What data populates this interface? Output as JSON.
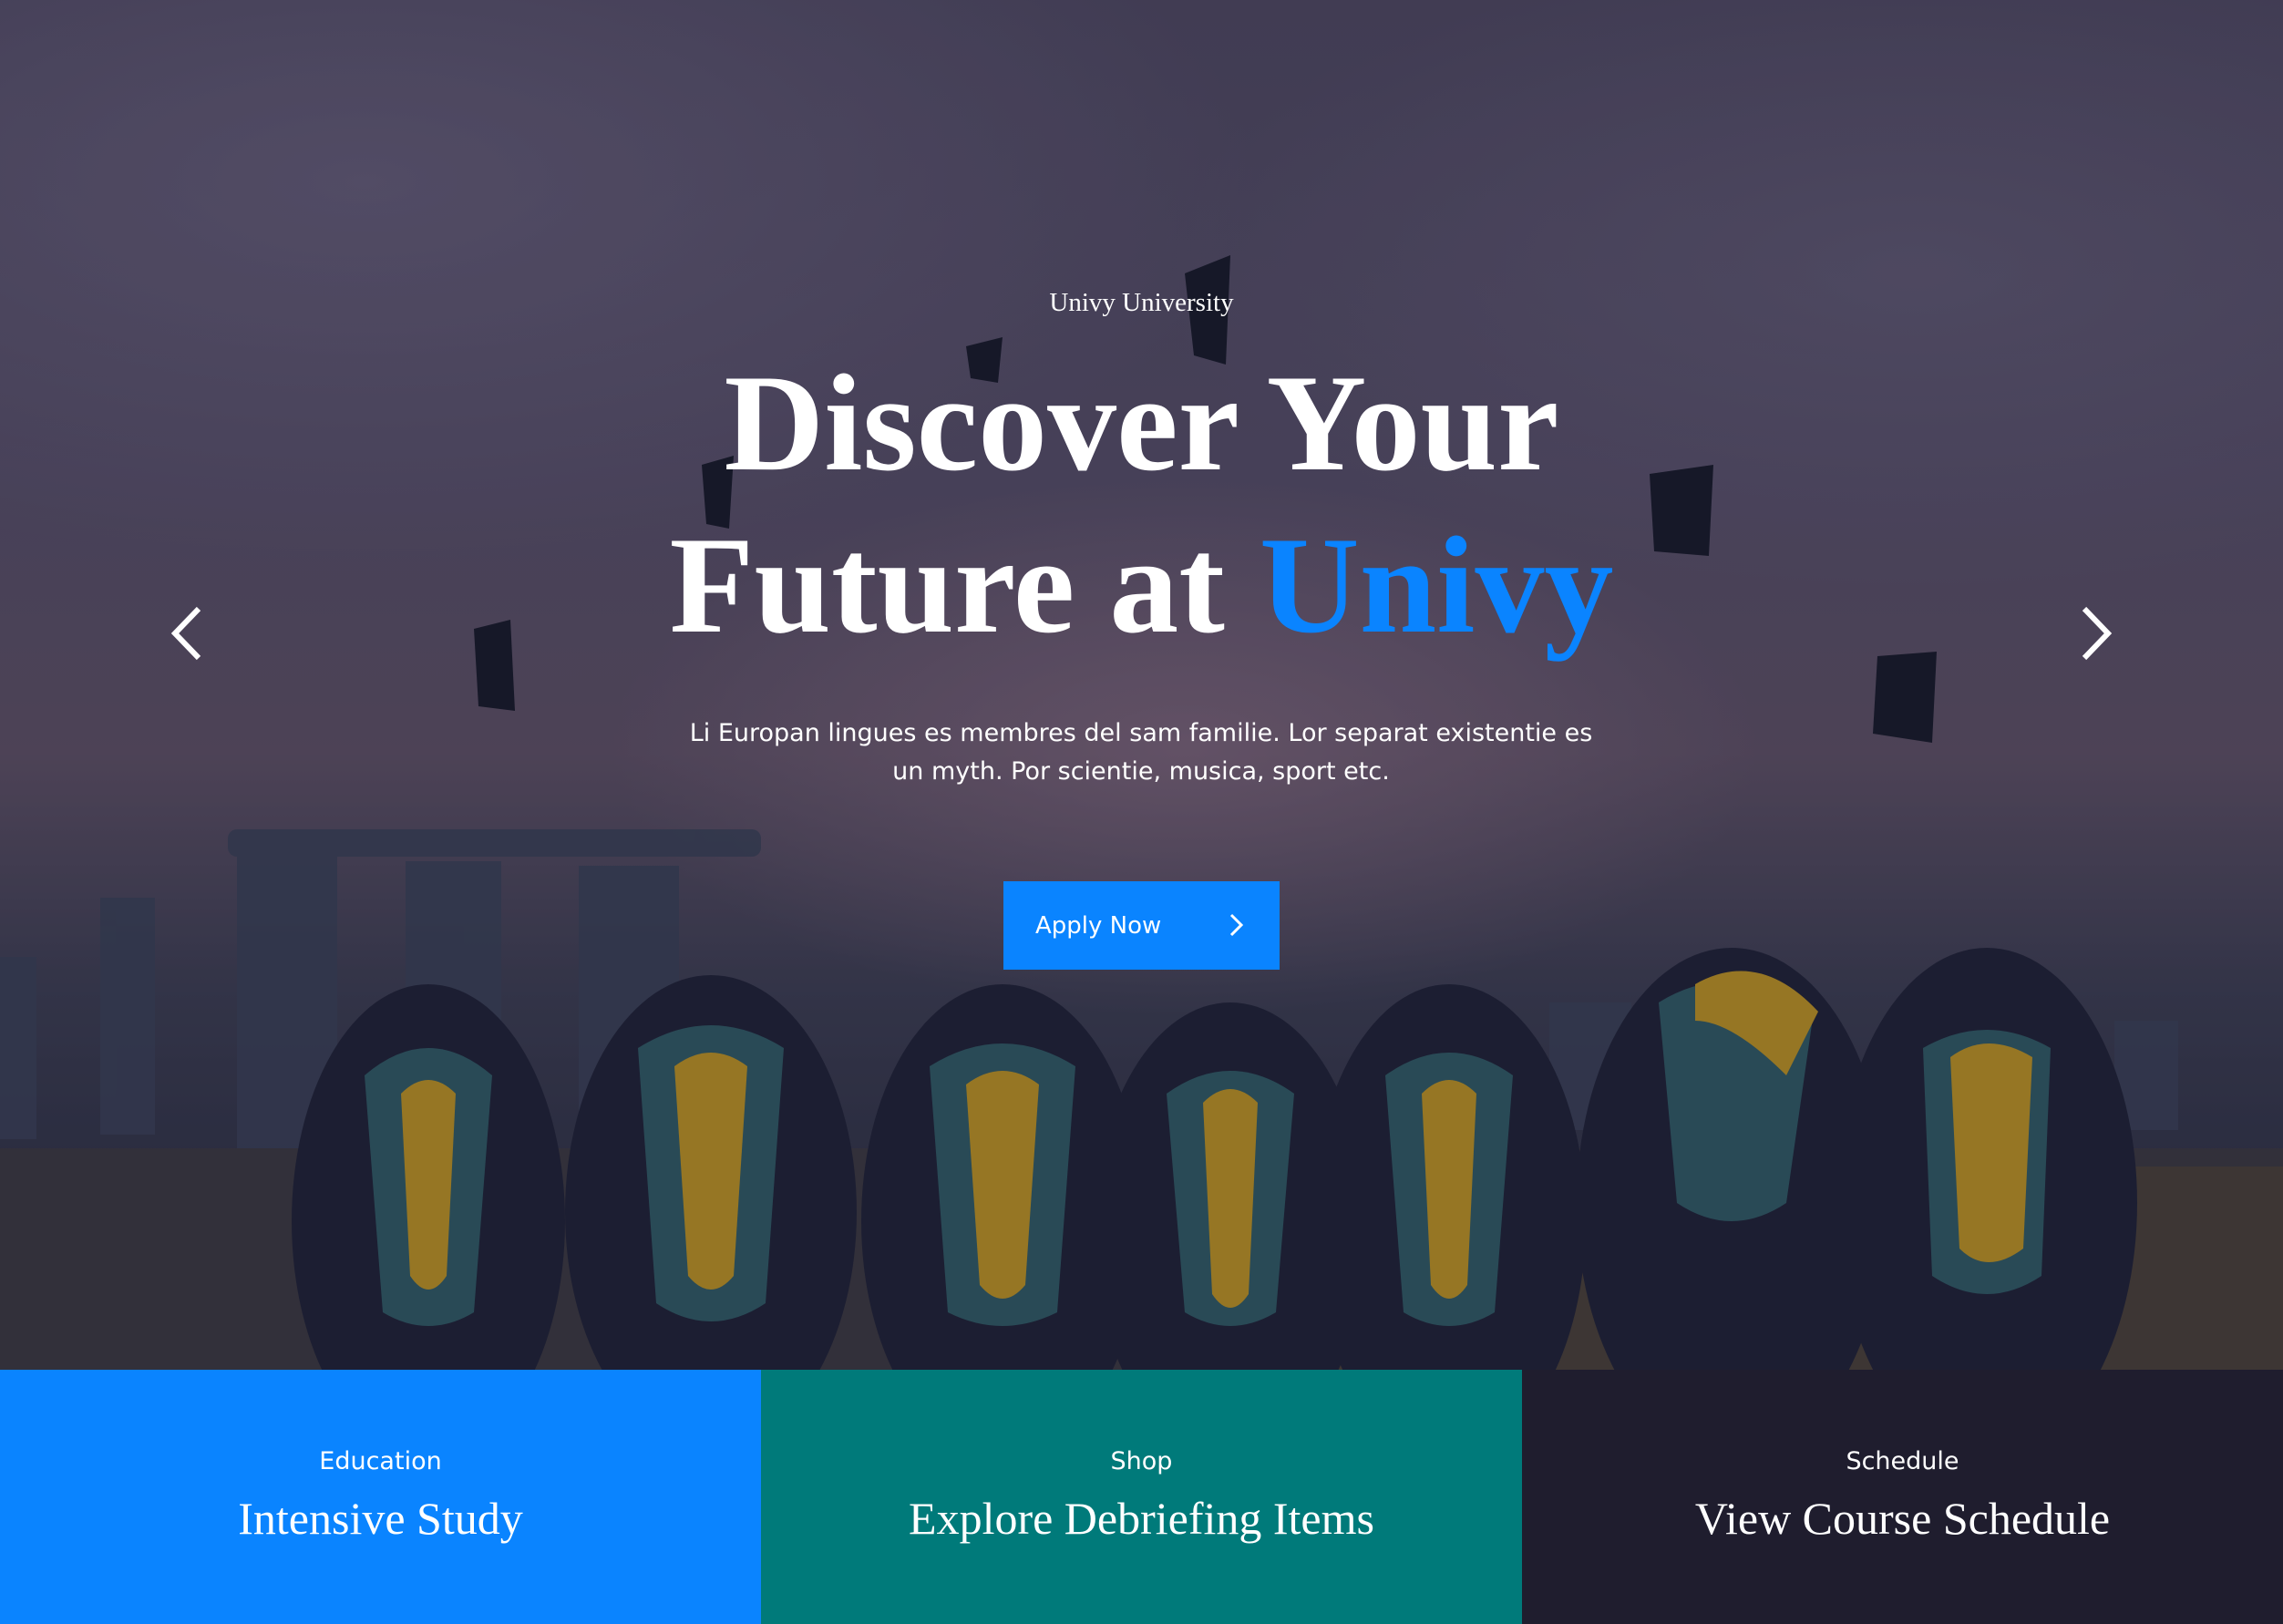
{
  "hero": {
    "eyebrow": "Univy University",
    "headline_line1": "Discover Your",
    "headline_line2_prefix": "Future at ",
    "headline_accent": "Univy",
    "lead": "Li Europan lingues es membres del sam familie. Lor separat existentie es un myth. Por scientie, musica, sport etc.",
    "cta_label": "Apply Now",
    "prev_icon": "chevron-left-icon",
    "next_icon": "chevron-right-icon",
    "photo": "graduates-throwing-caps"
  },
  "features": [
    {
      "kicker": "Education",
      "title": "Intensive Study",
      "color": "#0a84ff"
    },
    {
      "kicker": "Shop",
      "title": "Explore Debriefing Items",
      "color": "#007a7a"
    },
    {
      "kicker": "Schedule",
      "title": "View Course Schedule",
      "color": "#1f1d2e"
    }
  ],
  "colors": {
    "accent": "#0a84ff",
    "teal": "#007a7a",
    "dark": "#1f1d2e"
  }
}
